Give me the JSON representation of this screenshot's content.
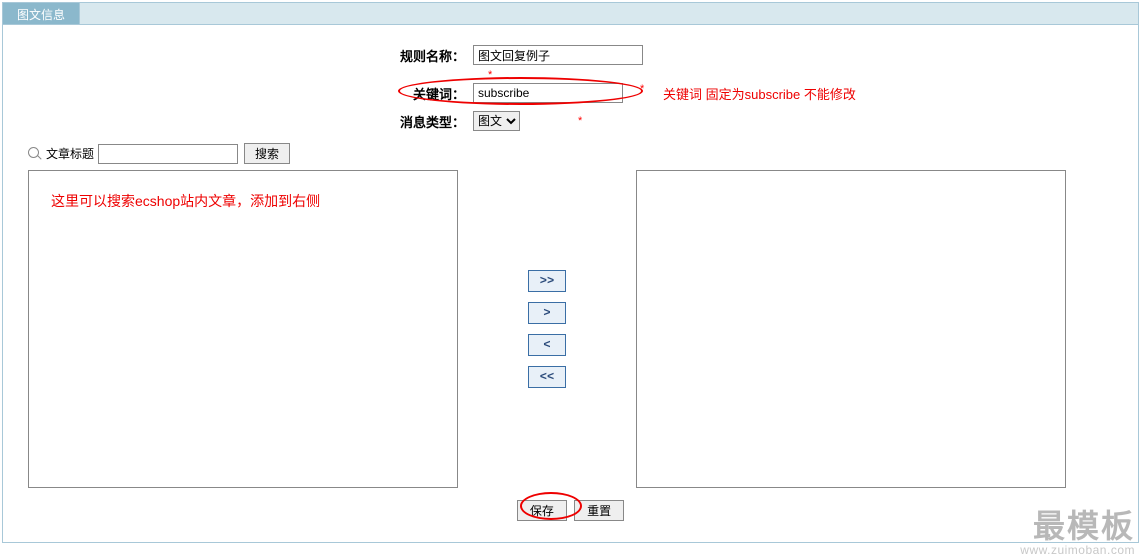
{
  "tab": {
    "title": "图文信息"
  },
  "form": {
    "rule_name_label": "规则名称：",
    "rule_name_value": "图文回复例子",
    "keyword_label": "关键词：",
    "keyword_value": "subscribe",
    "msg_type_label": "消息类型：",
    "msg_type_value": "图文"
  },
  "annotations": {
    "keyword_note": "关键词 固定为subscribe 不能修改",
    "left_hint": "这里可以搜索ecshop站内文章，添加到右侧"
  },
  "search": {
    "label": "文章标题",
    "value": "",
    "button": "搜索"
  },
  "transfer": {
    "add_all": ">>",
    "add_one": ">",
    "remove_one": "<",
    "remove_all": "<<"
  },
  "footer": {
    "save": "保存",
    "reset": "重置"
  },
  "watermark": {
    "big": "最模板",
    "small": "www.zuimoban.com"
  }
}
